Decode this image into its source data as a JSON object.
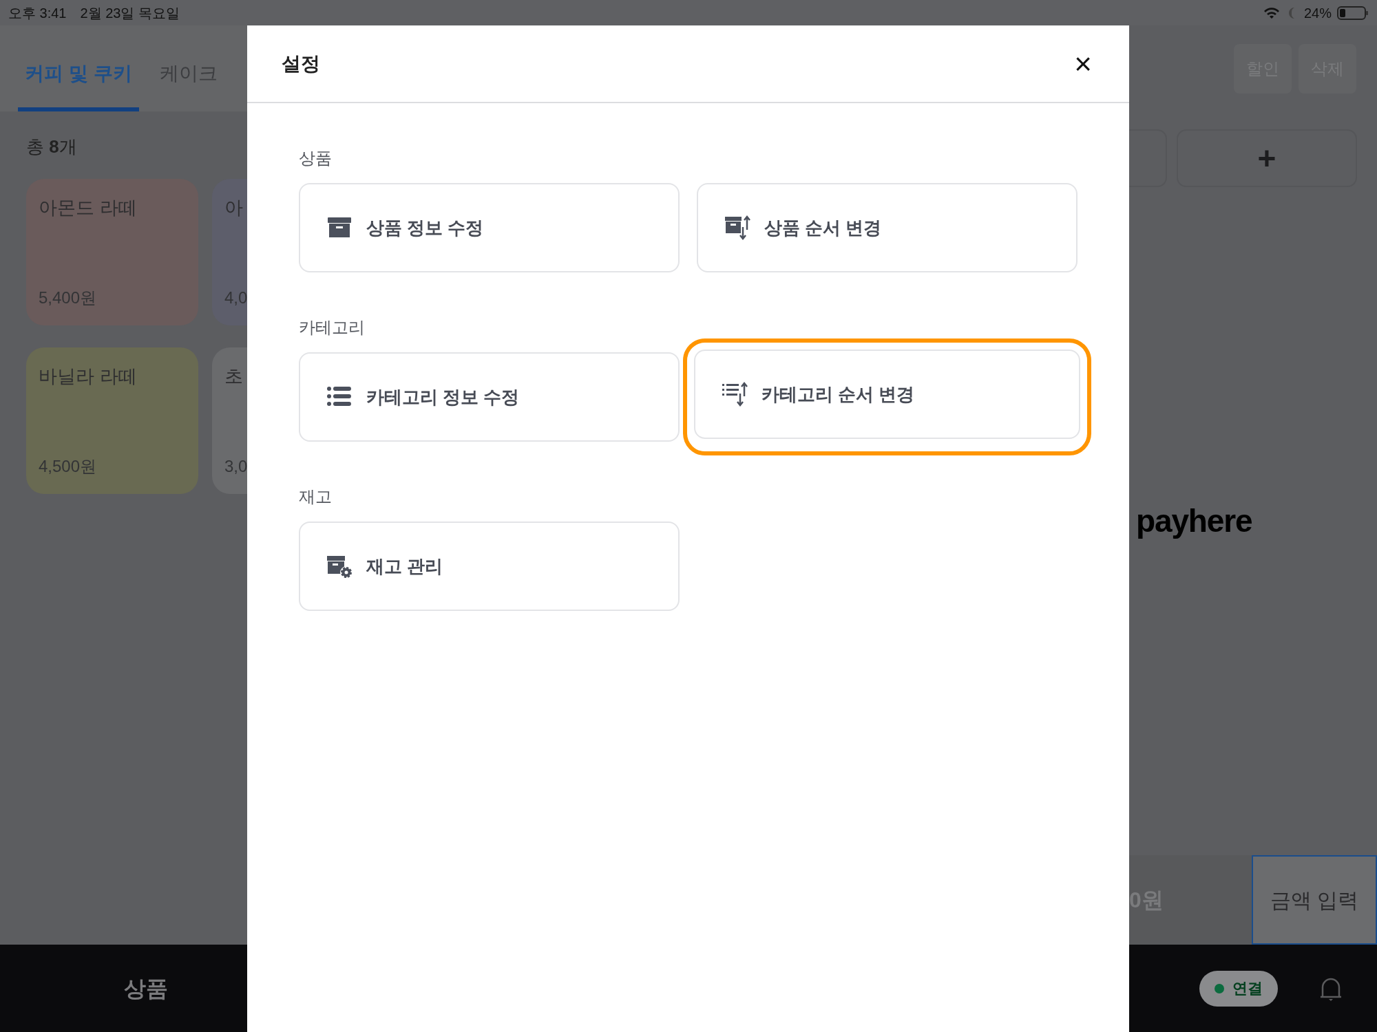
{
  "status_bar": {
    "time": "오후 3:41",
    "date": "2월 23일 목요일",
    "battery": "24%"
  },
  "tabs": [
    {
      "label": "커피 및 쿠키",
      "selected": true
    },
    {
      "label": "케이크",
      "selected": false
    }
  ],
  "total": "총 **8**개",
  "products": [
    {
      "name": "아몬드 라떼",
      "price": "5,400원",
      "color": "#6a5b5b"
    },
    {
      "name": "아",
      "price": "4,0",
      "color": "#5d5e6b"
    },
    {
      "name": "바닐라 라떼",
      "price": "4,500원",
      "color": "#696a52"
    },
    {
      "name": "초",
      "price": "3,0",
      "color": "#6a6b6d"
    }
  ],
  "order_panel": {
    "buttons": [
      "할인",
      "삭제"
    ],
    "add_button": "+",
    "logo": "payhere",
    "amount": "0원",
    "amount_input": "금액 입력"
  },
  "bottom_bar": {
    "nav_label": "상품",
    "connection": "연결"
  },
  "modal": {
    "title": "설정",
    "close": "×",
    "sections": [
      {
        "label": "상품",
        "items": [
          {
            "label": "상품 정보 수정",
            "kind": "box",
            "highlighted": false
          },
          {
            "label": "상품 순서 변경",
            "kind": "box-sort",
            "highlighted": false
          }
        ]
      },
      {
        "label": "카테고리",
        "items": [
          {
            "label": "카테고리 정보 수정",
            "kind": "list",
            "highlighted": false
          },
          {
            "label": "카테고리 순서 변경",
            "kind": "list-sort",
            "highlighted": true
          }
        ]
      },
      {
        "label": "재고",
        "items": [
          {
            "label": "재고 관리",
            "kind": "box-gear",
            "highlighted": false
          }
        ]
      }
    ]
  }
}
